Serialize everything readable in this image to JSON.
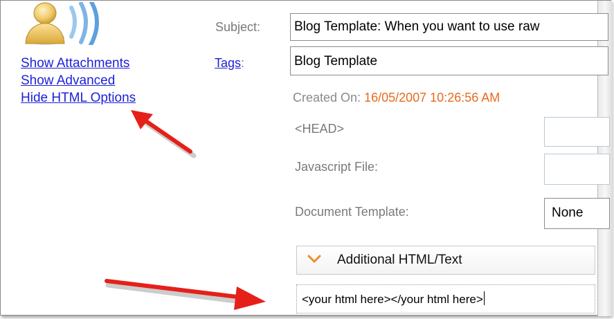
{
  "sidebar": {
    "links": [
      {
        "label": "Show Attachments"
      },
      {
        "label": "Show Advanced"
      },
      {
        "label": "Hide HTML Options"
      }
    ]
  },
  "form": {
    "subject_label": "Subject:",
    "subject_value": "Blog Template: When you want to use raw",
    "tags_label": "Tags",
    "tags_colon": ":",
    "tags_value": "Blog Template",
    "created_label": "Created On:",
    "created_value": "16/05/2007 10:26:56 AM",
    "head_label": "<HEAD>",
    "javascript_label": "Javascript File:",
    "document_template_label": "Document Template:",
    "document_template_value": "None",
    "additional_title": "Additional HTML/Text",
    "additional_value": "<your html here></your html here>"
  },
  "colors": {
    "link": "#1d22d6",
    "label": "#7a7a7a",
    "date": "#e66b1e",
    "arrow": "#e52019",
    "chevron": "#f08a24"
  }
}
